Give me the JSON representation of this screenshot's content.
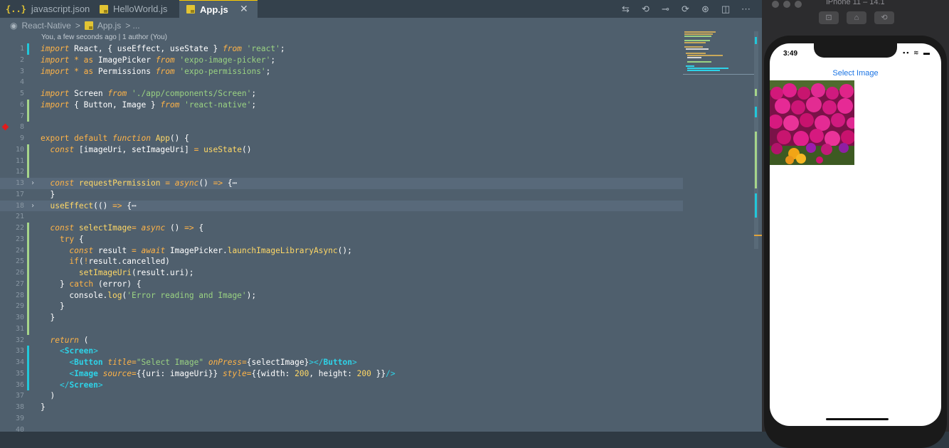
{
  "editor": {
    "tabs": [
      {
        "label": "javascript.json",
        "icon": "json-braces-icon"
      },
      {
        "label": "HelloWorld.js",
        "icon": "js-file-icon"
      },
      {
        "label": "App.js",
        "icon": "js-file-icon",
        "active": true
      }
    ],
    "close_glyph": "✕",
    "toolbar_icons": [
      "git-compare-icon",
      "go-back-icon",
      "git-commit-icon",
      "go-forward-icon",
      "extension-icon",
      "split-editor-icon",
      "more-actions-icon"
    ],
    "toolbar_glyphs": [
      "⇆",
      "⟲",
      "⊸",
      "⟳",
      "⊛",
      "◫",
      "⋯"
    ],
    "breadcrumb": {
      "icon_glyph": "◉",
      "folder": "React-Native",
      "sep": ">",
      "file": "App.js",
      "sep2": "> ..."
    },
    "blame": "You, a few seconds ago | 1 author (You)"
  },
  "code_lines": [
    {
      "n": "1",
      "g": "mod",
      "toks": [
        [
          "ki",
          "import"
        ],
        [
          "p",
          " React, { useEffect, useState } "
        ],
        [
          "ki",
          "from"
        ],
        [
          "p",
          " "
        ],
        [
          "s",
          "'react'"
        ],
        [
          "p",
          ";"
        ]
      ]
    },
    {
      "n": "2",
      "toks": [
        [
          "ki",
          "import"
        ],
        [
          "p",
          " "
        ],
        [
          "o",
          "*"
        ],
        [
          "p",
          " "
        ],
        [
          "k",
          "as"
        ],
        [
          "p",
          " ImagePicker "
        ],
        [
          "ki",
          "from"
        ],
        [
          "p",
          " "
        ],
        [
          "s",
          "'expo-image-picker'"
        ],
        [
          "p",
          ";"
        ]
      ]
    },
    {
      "n": "3",
      "toks": [
        [
          "ki",
          "import"
        ],
        [
          "p",
          " "
        ],
        [
          "o",
          "*"
        ],
        [
          "p",
          " "
        ],
        [
          "k",
          "as"
        ],
        [
          "p",
          " Permissions "
        ],
        [
          "ki",
          "from"
        ],
        [
          "p",
          " "
        ],
        [
          "s",
          "'expo-permissions'"
        ],
        [
          "p",
          ";"
        ]
      ]
    },
    {
      "n": "4",
      "toks": []
    },
    {
      "n": "5",
      "toks": [
        [
          "ki",
          "import"
        ],
        [
          "p",
          " Screen "
        ],
        [
          "ki",
          "from"
        ],
        [
          "p",
          " "
        ],
        [
          "s",
          "'./app/components/Screen'"
        ],
        [
          "p",
          ";"
        ]
      ]
    },
    {
      "n": "6",
      "g": "add",
      "toks": [
        [
          "ki",
          "import"
        ],
        [
          "p",
          " { Button, Image } "
        ],
        [
          "ki",
          "from"
        ],
        [
          "p",
          " "
        ],
        [
          "s",
          "'react-native'"
        ],
        [
          "p",
          ";"
        ]
      ]
    },
    {
      "n": "7",
      "g": "add",
      "toks": []
    },
    {
      "n": "8",
      "bp": true,
      "toks": []
    },
    {
      "n": "9",
      "toks": [
        [
          "k",
          "export default "
        ],
        [
          "ki",
          "function"
        ],
        [
          "p",
          " "
        ],
        [
          "f",
          "App"
        ],
        [
          "p",
          "() {"
        ]
      ]
    },
    {
      "n": "10",
      "g": "add",
      "toks": [
        [
          "p",
          "  "
        ],
        [
          "ki",
          "const"
        ],
        [
          "p",
          " [imageUri, setImageUri] "
        ],
        [
          "o",
          "="
        ],
        [
          "p",
          " "
        ],
        [
          "f",
          "useState"
        ],
        [
          "p",
          "()"
        ]
      ]
    },
    {
      "n": "11",
      "g": "add",
      "toks": []
    },
    {
      "n": "12",
      "g": "add",
      "toks": []
    },
    {
      "n": "13",
      "fold": "›",
      "hl": true,
      "toks": [
        [
          "p",
          "  "
        ],
        [
          "ki",
          "const"
        ],
        [
          "p",
          " "
        ],
        [
          "f",
          "requestPermission"
        ],
        [
          "p",
          " "
        ],
        [
          "o",
          "="
        ],
        [
          "p",
          " "
        ],
        [
          "ki",
          "async"
        ],
        [
          "p",
          "() "
        ],
        [
          "o",
          "=>"
        ],
        [
          "p",
          " {⋯"
        ]
      ]
    },
    {
      "n": "17",
      "toks": [
        [
          "p",
          "  }"
        ]
      ]
    },
    {
      "n": "18",
      "fold": "›",
      "hl": true,
      "toks": [
        [
          "p",
          "  "
        ],
        [
          "f",
          "useEffect"
        ],
        [
          "p",
          "(() "
        ],
        [
          "o",
          "=>"
        ],
        [
          "p",
          " {⋯"
        ]
      ]
    },
    {
      "n": "21",
      "toks": []
    },
    {
      "n": "22",
      "g": "add",
      "toks": [
        [
          "p",
          "  "
        ],
        [
          "ki",
          "const"
        ],
        [
          "p",
          " "
        ],
        [
          "f",
          "selectImage"
        ],
        [
          "o",
          "="
        ],
        [
          "p",
          " "
        ],
        [
          "ki",
          "async"
        ],
        [
          "p",
          " () "
        ],
        [
          "o",
          "=>"
        ],
        [
          "p",
          " {"
        ]
      ]
    },
    {
      "n": "23",
      "g": "add",
      "toks": [
        [
          "p",
          "    "
        ],
        [
          "k",
          "try"
        ],
        [
          "p",
          " {"
        ]
      ]
    },
    {
      "n": "24",
      "g": "add",
      "toks": [
        [
          "p",
          "      "
        ],
        [
          "ki",
          "const"
        ],
        [
          "p",
          " result "
        ],
        [
          "o",
          "="
        ],
        [
          "p",
          " "
        ],
        [
          "ki",
          "await"
        ],
        [
          "p",
          " ImagePicker."
        ],
        [
          "f",
          "launchImageLibraryAsync"
        ],
        [
          "p",
          "();"
        ]
      ]
    },
    {
      "n": "25",
      "g": "add",
      "toks": [
        [
          "p",
          "      "
        ],
        [
          "k",
          "if"
        ],
        [
          "p",
          "("
        ],
        [
          "o",
          "!"
        ],
        [
          "p",
          "result.cancelled)"
        ]
      ]
    },
    {
      "n": "26",
      "g": "add",
      "toks": [
        [
          "p",
          "        "
        ],
        [
          "f",
          "setImageUri"
        ],
        [
          "p",
          "(result.uri);"
        ]
      ]
    },
    {
      "n": "27",
      "g": "add",
      "toks": [
        [
          "p",
          "    } "
        ],
        [
          "k",
          "catch"
        ],
        [
          "p",
          " (error) {"
        ]
      ]
    },
    {
      "n": "28",
      "g": "add",
      "toks": [
        [
          "p",
          "      console."
        ],
        [
          "f",
          "log"
        ],
        [
          "p",
          "("
        ],
        [
          "s",
          "'Error reading and Image'"
        ],
        [
          "p",
          ");"
        ]
      ]
    },
    {
      "n": "29",
      "g": "add",
      "toks": [
        [
          "p",
          "    }"
        ]
      ]
    },
    {
      "n": "30",
      "g": "add",
      "toks": [
        [
          "p",
          "  }"
        ]
      ]
    },
    {
      "n": "31",
      "g": "add",
      "toks": []
    },
    {
      "n": "32",
      "toks": [
        [
          "p",
          "  "
        ],
        [
          "ki",
          "return"
        ],
        [
          "p",
          " ("
        ]
      ]
    },
    {
      "n": "33",
      "g": "mod",
      "toks": [
        [
          "p",
          "    "
        ],
        [
          "tp",
          "<"
        ],
        [
          "t",
          "Screen"
        ],
        [
          "tp",
          ">"
        ]
      ]
    },
    {
      "n": "34",
      "g": "mod",
      "toks": [
        [
          "p",
          "      "
        ],
        [
          "tp",
          "<"
        ],
        [
          "t",
          "Button"
        ],
        [
          "p",
          " "
        ],
        [
          "a",
          "title"
        ],
        [
          "o",
          "="
        ],
        [
          "s",
          "\"Select Image\""
        ],
        [
          "p",
          " "
        ],
        [
          "a",
          "onPress"
        ],
        [
          "o",
          "="
        ],
        [
          "p",
          "{selectImage}"
        ],
        [
          "tp",
          "></"
        ],
        [
          "t",
          "Button"
        ],
        [
          "tp",
          ">"
        ]
      ]
    },
    {
      "n": "35",
      "g": "mod",
      "toks": [
        [
          "p",
          "      "
        ],
        [
          "tp",
          "<"
        ],
        [
          "t",
          "Image"
        ],
        [
          "p",
          " "
        ],
        [
          "a",
          "source"
        ],
        [
          "o",
          "="
        ],
        [
          "p",
          "{{uri: imageUri}} "
        ],
        [
          "a",
          "style"
        ],
        [
          "o",
          "="
        ],
        [
          "p",
          "{{width: "
        ],
        [
          "n",
          "200"
        ],
        [
          "p",
          ", height: "
        ],
        [
          "n",
          "200"
        ],
        [
          "p",
          " }}"
        ],
        [
          "tp",
          "/>"
        ]
      ]
    },
    {
      "n": "36",
      "g": "mod",
      "toks": [
        [
          "p",
          "    "
        ],
        [
          "tp",
          "</"
        ],
        [
          "t",
          "Screen"
        ],
        [
          "tp",
          ">"
        ]
      ]
    },
    {
      "n": "37",
      "toks": [
        [
          "p",
          "  )"
        ]
      ]
    },
    {
      "n": "38",
      "toks": [
        [
          "p",
          "}"
        ]
      ]
    },
    {
      "n": "39",
      "toks": []
    },
    {
      "n": "40",
      "toks": []
    }
  ],
  "simulator": {
    "title": "iPhone 11 – 14.1",
    "buttons": [
      "screenshot-icon",
      "home-icon",
      "rotate-icon"
    ],
    "button_glyphs": [
      "⊡",
      "⌂",
      "⟲"
    ],
    "clock": "3:49",
    "status_glyphs": "▪▪ ≋ ▬",
    "select_image_label": "Select Image"
  }
}
